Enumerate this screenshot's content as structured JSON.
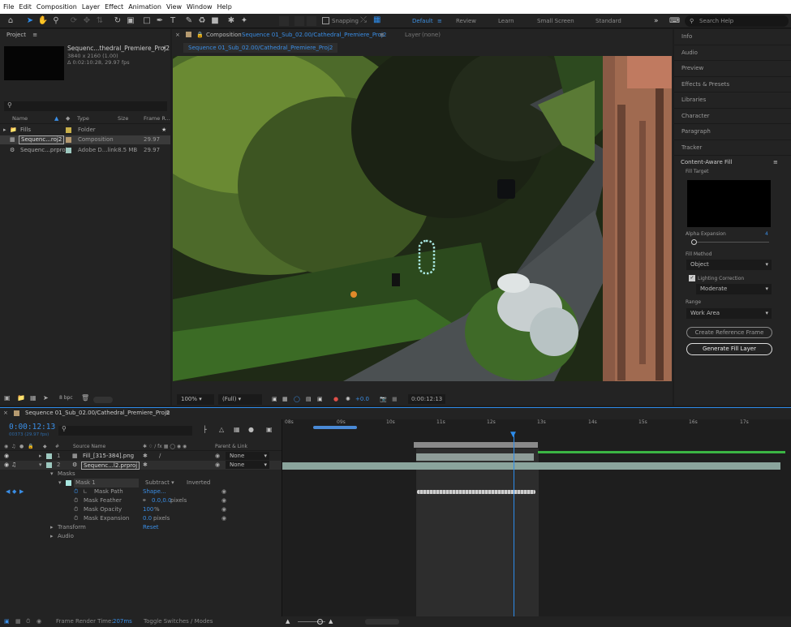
{
  "menu": [
    "File",
    "Edit",
    "Composition",
    "Layer",
    "Effect",
    "Animation",
    "View",
    "Window",
    "Help"
  ],
  "toolbar": {
    "snapping_label": "Snapping",
    "workspaces": [
      "Default",
      "Review",
      "Learn",
      "Small Screen",
      "Standard"
    ],
    "active_workspace": "Default",
    "search_placeholder": "Search Help"
  },
  "project": {
    "title": "Project",
    "item_name": "Sequenc...thedral_Premiere_Proj2",
    "item_res": "3840 x 2160 (1.00)",
    "item_dur": "Δ 0:02:10:28, 29.97 fps",
    "columns": [
      "Name",
      "Type",
      "Size",
      "Frame R..."
    ],
    "rows": [
      {
        "name": "Fills",
        "type": "Folder",
        "size": "",
        "fps": "",
        "color": "#c9b04a"
      },
      {
        "name": "Sequenc...roj2",
        "type": "Composition",
        "size": "",
        "fps": "29.97",
        "color": "#b59a70"
      },
      {
        "name": "Sequenc...prproj",
        "type": "Adobe D...link",
        "size": "8.5 MB",
        "fps": "29.97",
        "color": "#9ec9c0"
      }
    ],
    "bpc": "8 bpc"
  },
  "composition": {
    "tab_label": "Composition",
    "tab_name": "Sequence 01_Sub_02.00/Cathedral_Premiere_Proj2",
    "layer_label": "Layer",
    "layer_value": "(none)",
    "sub_tab": "Sequence 01_Sub_02.00/Cathedral_Premiere_Proj2",
    "zoom": "100%",
    "resolution": "(Full)",
    "exposure": "+0.0",
    "timecode": "0:00:12:13"
  },
  "right_panel": {
    "items": [
      "Info",
      "Audio",
      "Preview",
      "Effects & Presets",
      "Libraries",
      "Character",
      "Paragraph",
      "Tracker"
    ],
    "caf": {
      "title": "Content-Aware Fill",
      "fill_target": "Fill Target",
      "alpha_expansion_label": "Alpha Expansion",
      "alpha_expansion_value": "4",
      "fill_method_label": "Fill Method",
      "fill_method_value": "Object",
      "lighting_label": "Lighting Correction",
      "lighting_checked": true,
      "lighting_value": "Moderate",
      "range_label": "Range",
      "range_value": "Work Area",
      "create_ref_button": "Create Reference Frame",
      "generate_button": "Generate Fill Layer"
    }
  },
  "timeline": {
    "tab_name": "Sequence 01_Sub_02.00/Cathedral_Premiere_Proj2",
    "timecode": "0:00:12:13",
    "frame_info": "00373 (29.97 fps)",
    "col_source": "Source Name",
    "col_parent": "Parent & Link",
    "ruler": [
      "08s",
      "09s",
      "10s",
      "11s",
      "12s",
      "13s",
      "14s",
      "15s",
      "16s",
      "17s"
    ],
    "layers": [
      {
        "num": "1",
        "name": "Fill_[315-384].png",
        "parent": "None"
      },
      {
        "num": "2",
        "name": "Sequenc...l2.prproj",
        "parent": "None"
      }
    ],
    "masks_label": "Masks",
    "mask1": {
      "name": "Mask 1",
      "mode": "Subtract",
      "inverted": "Inverted"
    },
    "props": [
      {
        "name": "Mask Path",
        "value": "Shape...",
        "unit": ""
      },
      {
        "name": "Mask Feather",
        "value": "0.0,0.0",
        "unit": "pixels"
      },
      {
        "name": "Mask Opacity",
        "value": "100",
        "unit": "%"
      },
      {
        "name": "Mask Expansion",
        "value": "0.0",
        "unit": "pixels"
      }
    ],
    "transform_label": "Transform",
    "transform_value": "Reset",
    "audio_label": "Audio"
  },
  "status": {
    "render_label": "Frame Render Time:",
    "render_value": "207ms",
    "toggle_label": "Toggle Switches / Modes"
  },
  "colors": {
    "accent": "#2d8ceb",
    "panel": "#232323",
    "bg": "#1d1d1d",
    "layer_bar": "#8aa49c"
  }
}
